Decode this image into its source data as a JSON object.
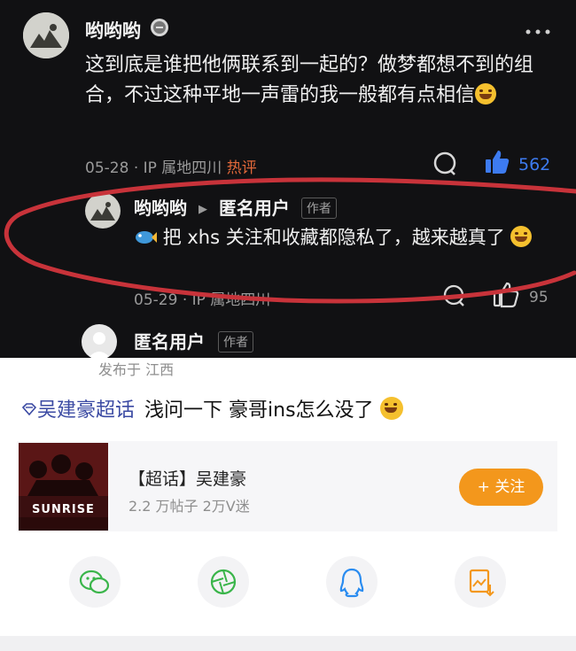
{
  "comment": {
    "username": "哟哟哟",
    "text": "这到底是谁把他俩联系到一起的？做梦都想不到的组合，不过这种平地一声雷的我一般都有点相信",
    "date": "05-28",
    "ip": "· IP 属地四川",
    "hot_label": "热评",
    "like_count": "562",
    "more_icon": "more-dots-icon"
  },
  "reply": {
    "username": "哟哟哟",
    "to_user": "匿名用户",
    "author_badge": "作者",
    "text": "把 xhs 关注和收藏都隐私了，越来越真了",
    "date": "05-29",
    "ip": "· IP 属地四川",
    "like_count": "95"
  },
  "post": {
    "username": "匿名用户",
    "author_badge": "作者",
    "location": "发布于 江西",
    "topic_tag": "吴建豪超话",
    "text": "浅问一下 豪哥ins怎么没了"
  },
  "topic_card": {
    "title": "【超话】吴建豪",
    "stats": "2.2 万帖子 2万V迷",
    "poster_text": "SUNRISE",
    "follow_label": "+ 关注"
  },
  "share": {
    "icons": [
      "wechat-icon",
      "moments-icon",
      "qq-icon",
      "save-image-icon"
    ]
  },
  "colors": {
    "dark_bg": "#111113",
    "accent_orange": "#f3971c",
    "like_blue": "#3d7bf0",
    "hot_red": "#e0683a",
    "annotation_red": "#c8333a"
  }
}
